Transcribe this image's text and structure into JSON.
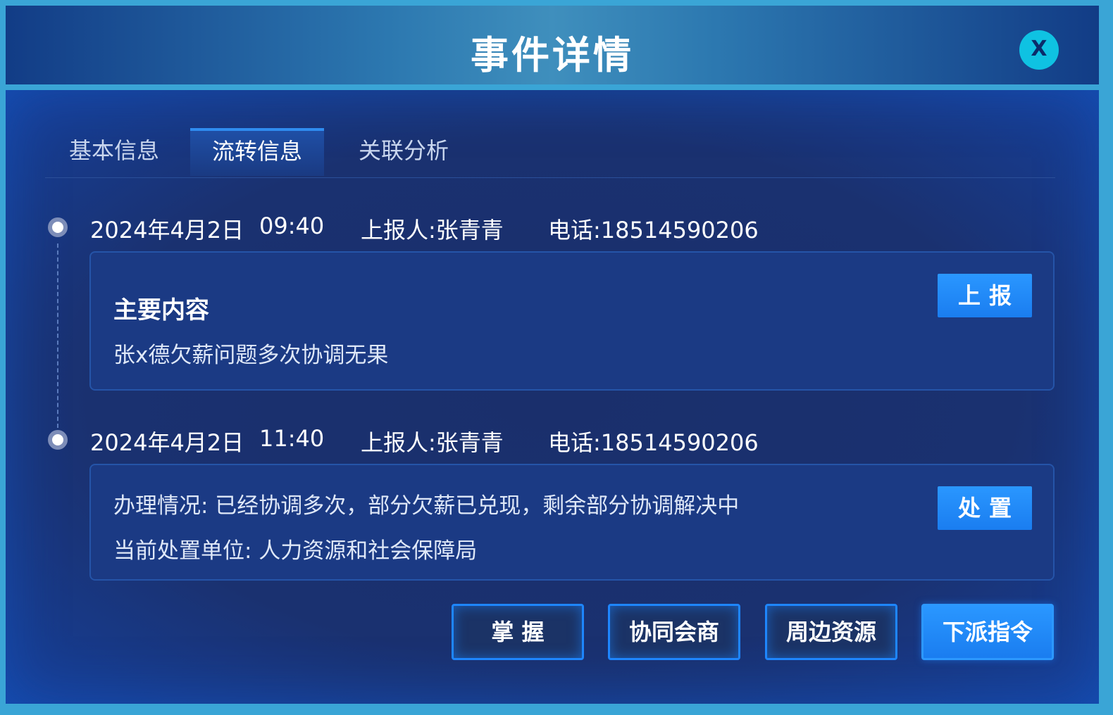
{
  "dialog": {
    "title": "事件详情",
    "close_label": "X"
  },
  "tabs": [
    {
      "label": "基本信息",
      "active": false
    },
    {
      "label": "流转信息",
      "active": true
    },
    {
      "label": "关联分析",
      "active": false
    }
  ],
  "timeline": [
    {
      "date": "2024年4月2日",
      "time": "09:40",
      "reporter": "上报人:张青青",
      "phone": "电话:18514590206",
      "card": {
        "title": "主要内容",
        "text": "张x德欠薪问题多次协调无果",
        "button_label": "上报"
      }
    },
    {
      "date": "2024年4月2日",
      "time": "11:40",
      "reporter": "上报人:张青青",
      "phone": "电话:18514590206",
      "card": {
        "line1": "办理情况:  已经协调多次，部分欠薪已兑现，剩余部分协调解决中",
        "line2": "当前处置单位:  人力资源和社会保障局",
        "button_label": "处置"
      }
    }
  ],
  "actions": [
    {
      "label": "掌 握",
      "primary": false
    },
    {
      "label": "协同会商",
      "primary": false
    },
    {
      "label": "周边资源",
      "primary": false
    },
    {
      "label": "下派指令",
      "primary": true
    }
  ],
  "colors": {
    "frame": "#3aa5d6",
    "accent": "#1e86ff",
    "close_button": "#0fc2e2"
  }
}
